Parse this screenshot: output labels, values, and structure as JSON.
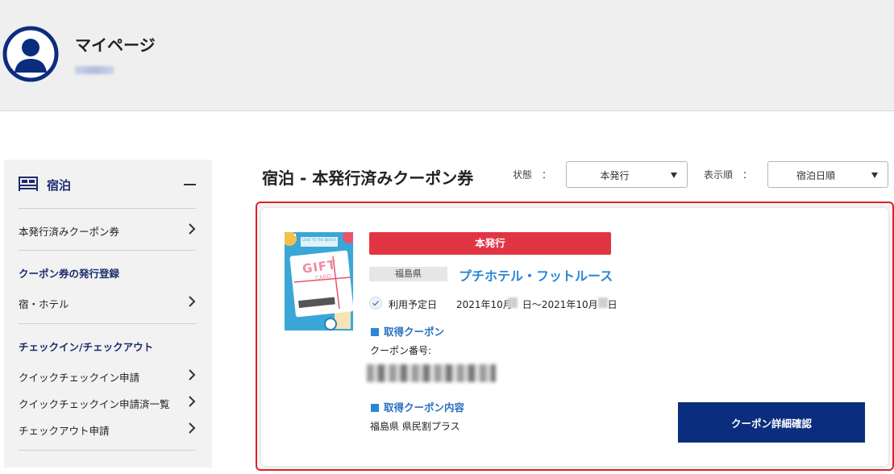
{
  "header": {
    "title": "マイページ"
  },
  "sidebar": {
    "section_title": "宿泊",
    "items": [
      {
        "label": "本発行済みクーポン券"
      },
      {
        "label": "宿・ホテル"
      },
      {
        "label": "クイックチェックイン申請"
      },
      {
        "label": "クイックチェックイン申請済一覧"
      },
      {
        "label": "チェックアウト申請"
      }
    ],
    "subsections": [
      {
        "label": "クーポン券の発行登録"
      },
      {
        "label": "チェックイン/チェックアウト"
      }
    ]
  },
  "main": {
    "title": "宿泊 - 本発行済みクーポン券",
    "status_filter": {
      "label": "状態　：",
      "value": "本発行"
    },
    "sort_filter": {
      "label": "表示順　：",
      "value": "宿泊日順"
    }
  },
  "card": {
    "thumbnail": {
      "text": "GIFT",
      "subtext": "CARD",
      "tag": "LOVE TO THE BEACH"
    },
    "status_badge": "本発行",
    "prefecture": "福島県",
    "hotel_name": "プチホテル・フットルース",
    "date_label": "利用予定日",
    "date_value": "2021年10月　日〜2021年10月　日",
    "coupon_section_title": "取得クーポン",
    "coupon_number_label": "クーポン番号:",
    "content_section_title": "取得クーポン内容",
    "content_value": "福島県 県民割プラス",
    "detail_button": "クーポン詳細確認"
  },
  "colors": {
    "accent_red": "#e23544",
    "link_blue": "#2a86d8",
    "navy": "#0b2d7e",
    "sidebar_heading": "#1c2c6e"
  }
}
